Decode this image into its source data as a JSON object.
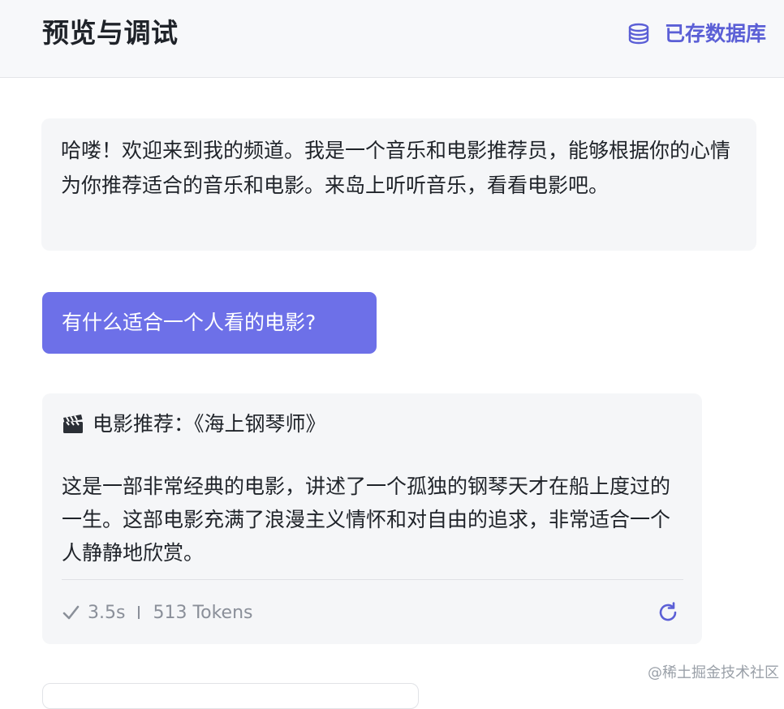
{
  "header": {
    "title": "预览与调试",
    "db_link_label": "已存数据库",
    "db_icon": "database-icon"
  },
  "conversation": {
    "bot_greeting": "哈喽！欢迎来到我的频道。我是一个音乐和电影推荐员，能够根据你的心情为你推荐适合的音乐和电影。来岛上听听音乐，看看电影吧。",
    "user_message": "有什么适合一个人看的电影?",
    "reply": {
      "title_icon": "clapper-board-icon",
      "title": "电影推荐：《海上钢琴师》",
      "body": "这是一部非常经典的电影，讲述了一个孤独的钢琴天才在船上度过的一生。这部电影充满了浪漫主义情怀和对自由的追求，非常适合一个人静静地欣赏。",
      "duration": "3.5s",
      "tokens": "513 Tokens",
      "status_icon": "checkmark-icon",
      "action_icon": "refresh-icon"
    }
  },
  "watermark": "@稀土掘金技术社区",
  "colors": {
    "accent": "#6d70e8",
    "link": "#5b5fd6",
    "bubble_bg": "#f5f6f8",
    "meta_text": "#8a8f99"
  }
}
